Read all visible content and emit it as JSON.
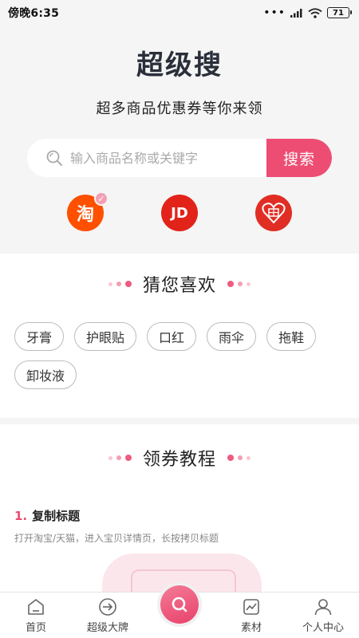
{
  "status_bar": {
    "time": "傍晚6:35",
    "signal_dots": "•••",
    "battery": "71"
  },
  "hero": {
    "title": "超级搜",
    "subtitle": "超多商品优惠券等你来领",
    "search": {
      "placeholder": "输入商品名称或关键字",
      "value": "",
      "button_label": "搜索"
    },
    "platforms": [
      {
        "name": "taobao",
        "label": "淘",
        "selected": true
      },
      {
        "name": "jd",
        "label": "JD"
      },
      {
        "name": "pinduoduo",
        "label": ""
      }
    ]
  },
  "guess": {
    "title": "猜您喜欢",
    "tags": [
      "牙膏",
      "护眼贴",
      "口红",
      "雨伞",
      "拖鞋",
      "卸妆液"
    ]
  },
  "tutorial": {
    "title": "领券教程",
    "step1": {
      "number": "1.",
      "title": "复制标题",
      "desc": "打开淘宝/天猫，进入宝贝详情页，长按拷贝标题"
    }
  },
  "bottom_nav": {
    "items": [
      "首页",
      "超级大牌",
      "",
      "素材",
      "个人中心"
    ]
  },
  "colors": {
    "accent": "#ee4d73",
    "taobao": "#ff5000",
    "jd": "#e2231a",
    "pdd": "#e02e24"
  }
}
